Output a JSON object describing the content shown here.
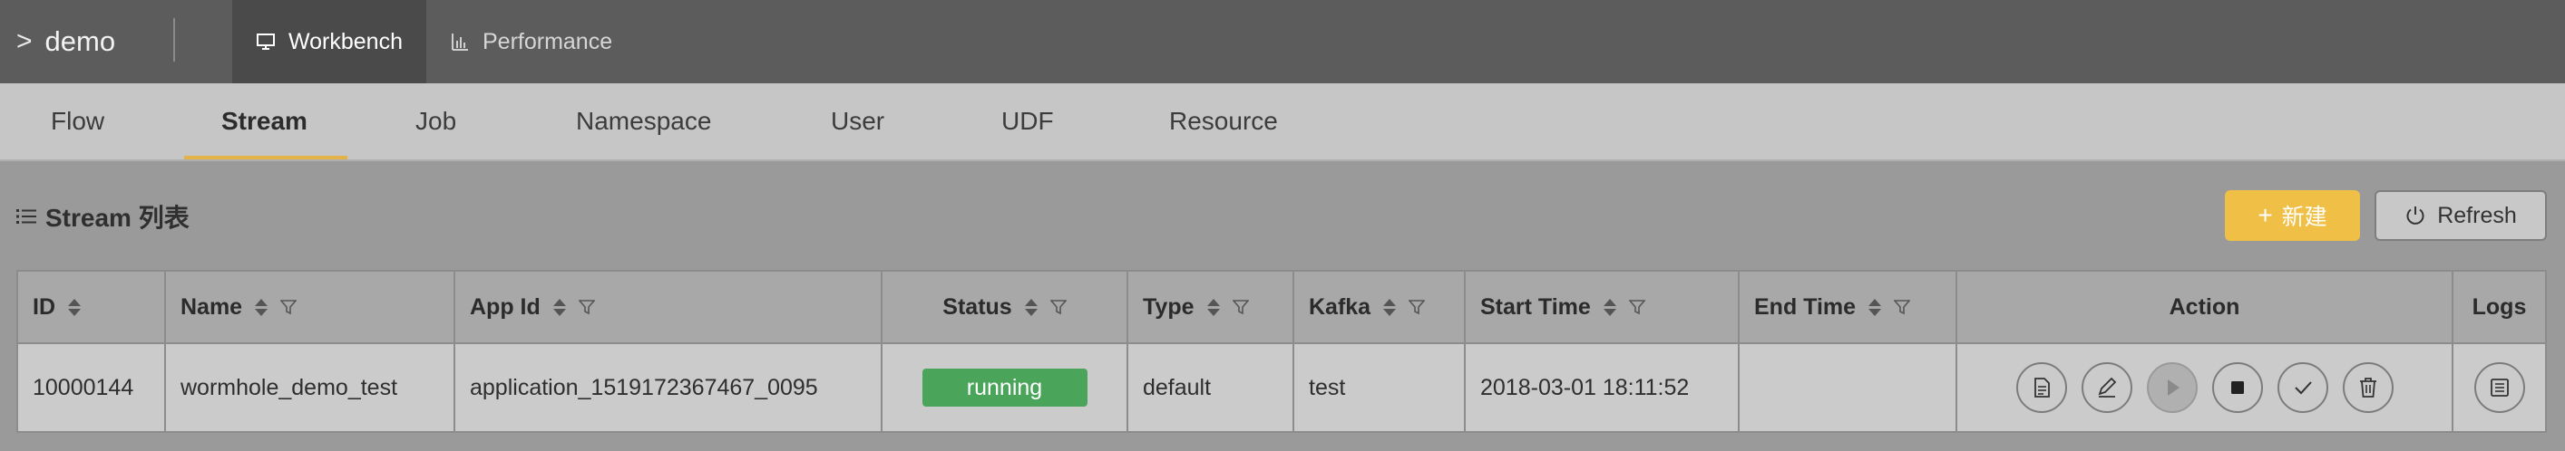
{
  "app": {
    "name": "demo"
  },
  "topnav": [
    {
      "label": "Workbench",
      "icon": "monitor-icon",
      "active": true
    },
    {
      "label": "Performance",
      "icon": "bar-chart-icon",
      "active": false
    }
  ],
  "tabs": [
    "Flow",
    "Stream",
    "Job",
    "Namespace",
    "User",
    "UDF",
    "Resource"
  ],
  "active_tab": "Stream",
  "section": {
    "title": "Stream 列表"
  },
  "buttons": {
    "new_label": "新建",
    "refresh_label": "Refresh"
  },
  "table": {
    "columns": [
      "ID",
      "Name",
      "App Id",
      "Status",
      "Type",
      "Kafka",
      "Start Time",
      "End Time",
      "Action",
      "Logs"
    ],
    "rows": [
      {
        "id": "10000144",
        "name": "wormhole_demo_test",
        "app_id": "application_1519172367467_0095",
        "status": "running",
        "type": "default",
        "kafka": "test",
        "start_time": "2018-03-01 18:11:52",
        "end_time": ""
      }
    ]
  },
  "colors": {
    "accent": "#f0bf45",
    "status_running": "#4aa45a",
    "topbar": "#5c5c5c"
  }
}
